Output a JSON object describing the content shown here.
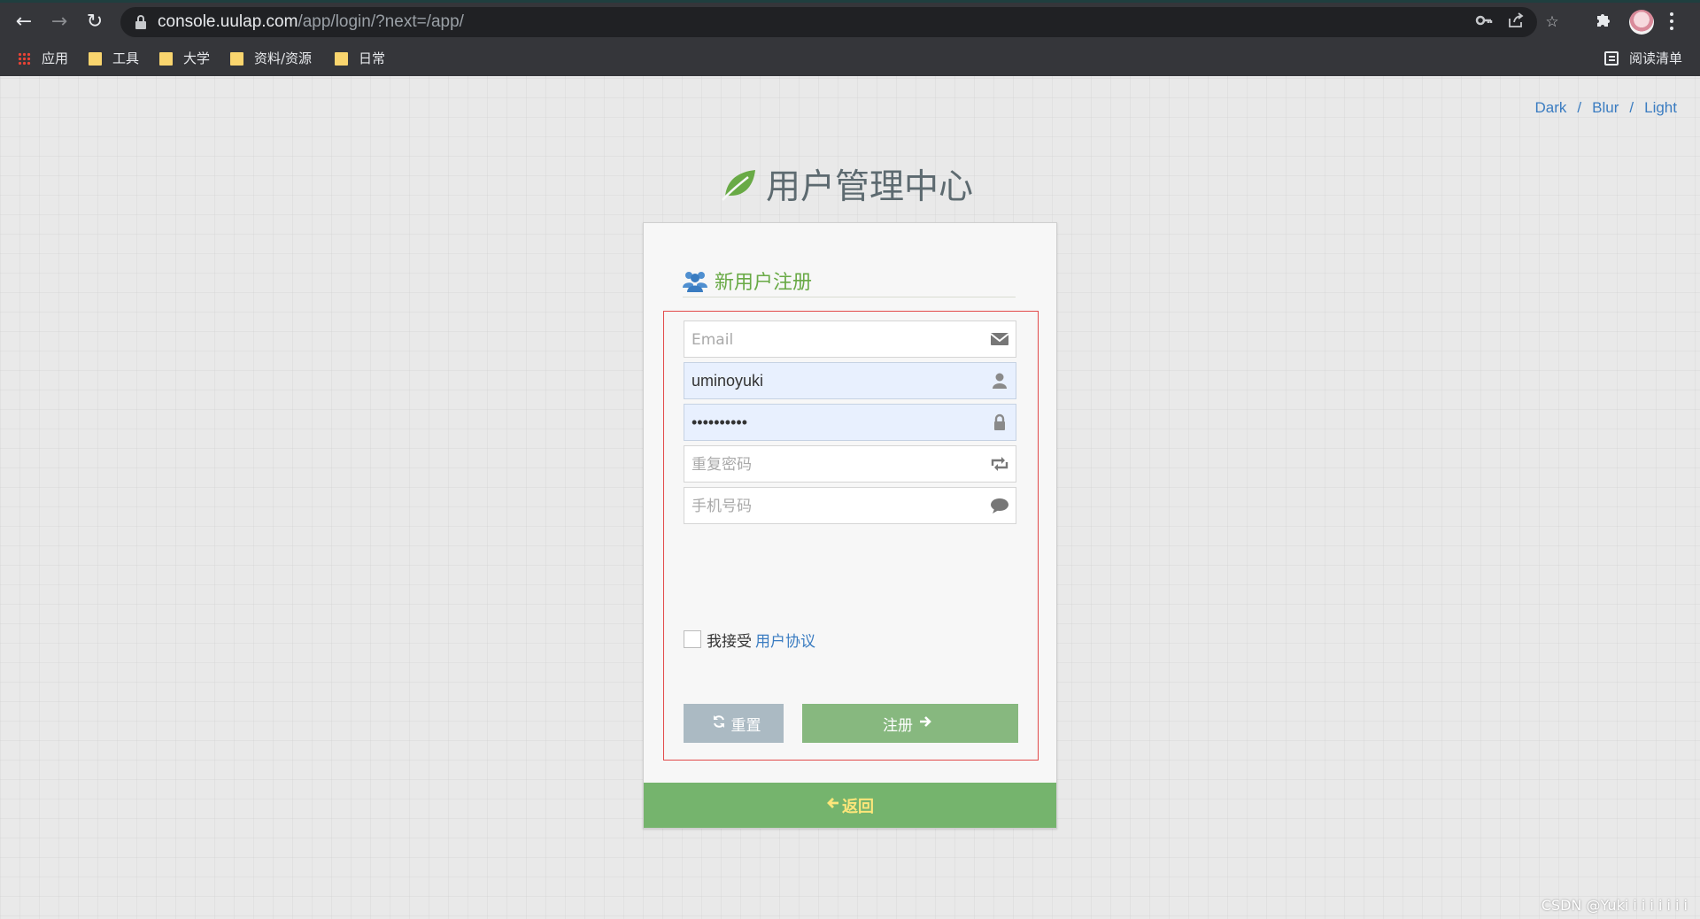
{
  "browser": {
    "url_host": "console.uulap.com",
    "url_path": "/app/login/?next=/app/",
    "bookmarks": [
      {
        "label": "应用",
        "icon": "apps-grid-icon"
      },
      {
        "label": "工具",
        "icon": "folder-icon"
      },
      {
        "label": "大学",
        "icon": "folder-icon"
      },
      {
        "label": "资料/资源",
        "icon": "folder-icon"
      },
      {
        "label": "日常",
        "icon": "folder-icon"
      }
    ],
    "reading_list": "阅读清单"
  },
  "theme": {
    "options": [
      "Dark",
      "Blur",
      "Light"
    ],
    "separator": "/"
  },
  "app": {
    "title": "用户管理中心",
    "accent": "#69aa46"
  },
  "register": {
    "heading": "新用户注册",
    "fields": {
      "email": {
        "placeholder": "Email",
        "value": ""
      },
      "username": {
        "placeholder": "",
        "value": "uminoyuki"
      },
      "password": {
        "placeholder": "",
        "value": "••••••••••"
      },
      "repeat_password": {
        "placeholder": "重复密码",
        "value": ""
      },
      "phone": {
        "placeholder": "手机号码",
        "value": ""
      }
    },
    "accept_text": "我接受",
    "agreement_link": "用户协议",
    "reset_label": "重置",
    "submit_label": "注册",
    "back_label": "返回"
  },
  "watermark": "CSDN @Yuki i i i i i i i"
}
